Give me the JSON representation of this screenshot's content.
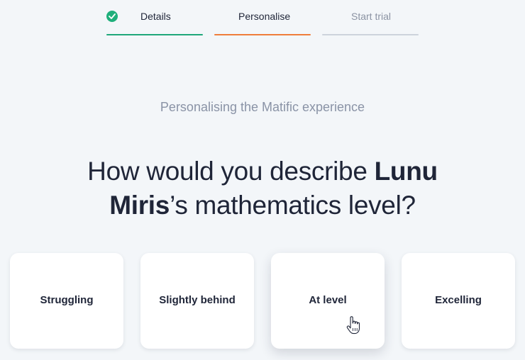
{
  "stepper": {
    "steps": [
      {
        "label": "Details",
        "state": "complete",
        "color": "#1fa77a"
      },
      {
        "label": "Personalise",
        "state": "active",
        "color": "#ef7d3b"
      },
      {
        "label": "Start trial",
        "state": "upcoming",
        "color": "#cdd3dc"
      }
    ]
  },
  "subtitle": "Personalising the Matific experience",
  "headline": {
    "prefix": "How would you describe ",
    "name": "Lunu Miris",
    "suffix": "’s mathematics level?"
  },
  "options": [
    {
      "label": "Struggling"
    },
    {
      "label": "Slightly behind"
    },
    {
      "label": "At level"
    },
    {
      "label": "Excelling"
    }
  ]
}
